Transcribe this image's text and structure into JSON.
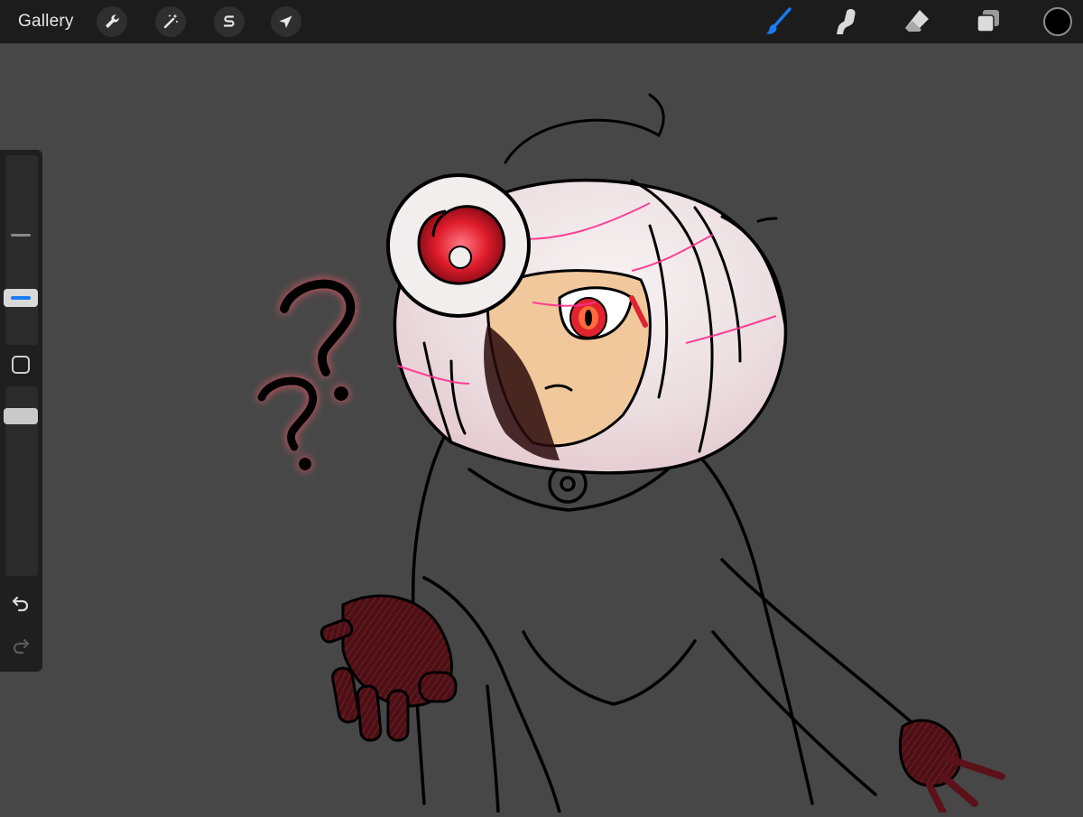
{
  "topbar": {
    "gallery_label": "Gallery",
    "left_tools": [
      {
        "name": "actions",
        "icon": "wrench-icon"
      },
      {
        "name": "adjustments",
        "icon": "magic-wand-icon"
      },
      {
        "name": "selection",
        "icon": "selection-s-icon"
      },
      {
        "name": "transform",
        "icon": "arrow-cursor-icon"
      }
    ],
    "right_tools": [
      {
        "name": "brush",
        "icon": "brush-icon",
        "active": true
      },
      {
        "name": "smudge",
        "icon": "smudge-finger-icon",
        "active": false
      },
      {
        "name": "eraser",
        "icon": "eraser-icon",
        "active": false
      },
      {
        "name": "layers",
        "icon": "layers-icon",
        "active": false
      }
    ],
    "current_color": "#000000",
    "accent_color": "#1a7cf5"
  },
  "sidebar": {
    "undo_icon": "undo-arrow-icon",
    "redo_icon": "redo-arrow-icon",
    "modify_icon": "rounded-square-icon"
  },
  "canvas": {
    "background": "#474747",
    "artwork": "character-illustration"
  }
}
